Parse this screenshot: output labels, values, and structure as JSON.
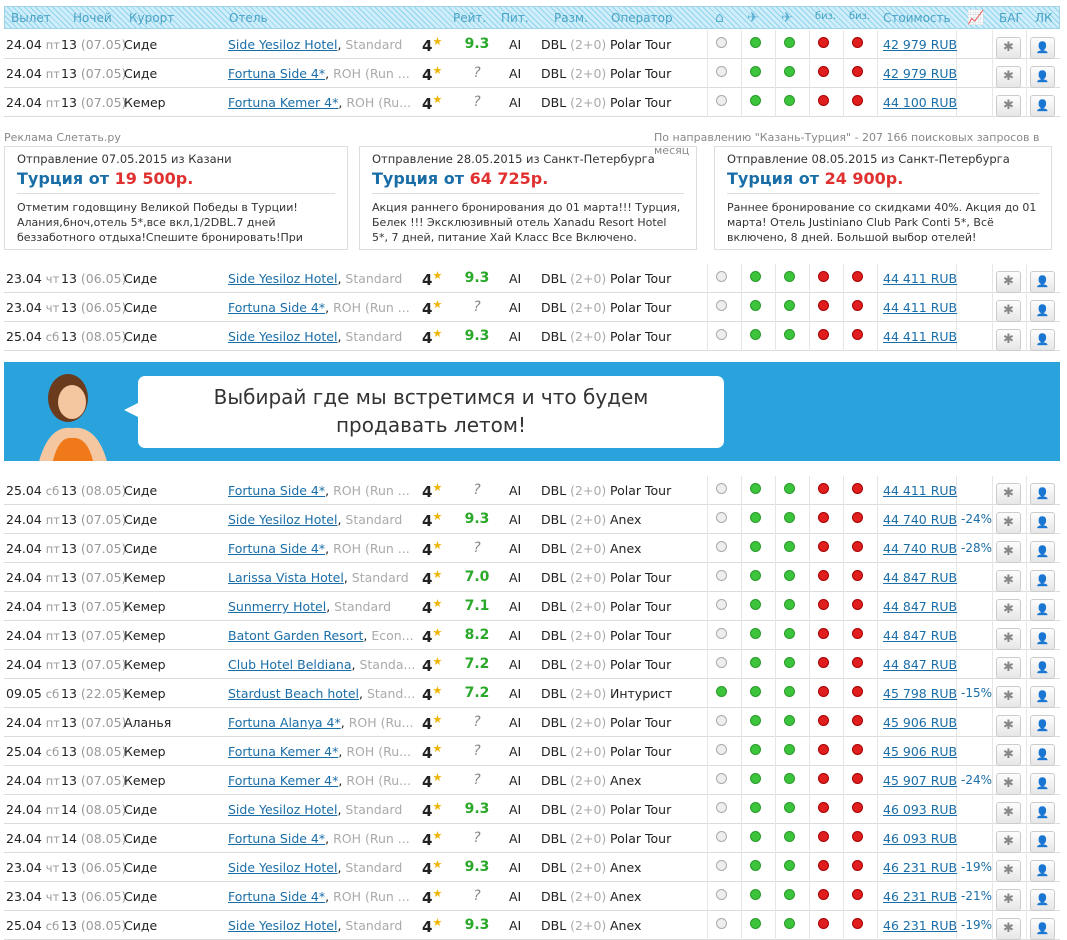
{
  "header": {
    "depart": "Вылет",
    "nights": "Ночей",
    "resort": "Курорт",
    "hotel": "Отель",
    "rating": "Рейт.",
    "meal": "Пит.",
    "room": "Разм.",
    "operator": "Оператор",
    "price": "Стоимость",
    "bag": "БАГ",
    "lk": "ЛК",
    "biz1": "биз.",
    "biz2": "биз."
  },
  "rows1": [
    {
      "date": "24.04",
      "dow": "пт",
      "nights": "13",
      "ret": "(07.05)",
      "resort": "Сиде",
      "hotel": "Side Yesiloz Hotel",
      "cat": "Standard",
      "stars": "4",
      "rating": "9.3",
      "meal": "AI",
      "room": "DBL",
      "rg": "(2+0)",
      "operator": "Polar Tour",
      "price": "42 979 RUB",
      "discount": "",
      "dots": "eggrr"
    },
    {
      "date": "24.04",
      "dow": "пт",
      "nights": "13",
      "ret": "(07.05)",
      "resort": "Сиде",
      "hotel": "Fortuna Side 4*",
      "cat": "ROH (Run ...",
      "stars": "4",
      "rating": "?",
      "meal": "AI",
      "room": "DBL",
      "rg": "(2+0)",
      "operator": "Polar Tour",
      "price": "42 979 RUB",
      "discount": "",
      "dots": "eggrr"
    },
    {
      "date": "24.04",
      "dow": "пт",
      "nights": "13",
      "ret": "(07.05)",
      "resort": "Кемер",
      "hotel": "Fortuna Kemer 4*",
      "cat": "ROH (Ru...",
      "stars": "4",
      "rating": "?",
      "meal": "AI",
      "room": "DBL",
      "rg": "(2+0)",
      "operator": "Polar Tour",
      "price": "44 100 RUB",
      "discount": "",
      "dots": "eggrr"
    }
  ],
  "ad": {
    "label": "Реклама Слетать.ру",
    "stats": "По направлению \"Казань-Турция\" - 207 166 поисковых запросов в месяц",
    "boxes": [
      {
        "depart": "Отправление 07.05.2015 из Казани",
        "dest": "Турция от",
        "price": "19 500р.",
        "text": "Отметим годовщину Великой Победы в Турции! Алания,6ноч,отель 5*,все вкл,1/2DBL.7 дней беззаботного отдыха!Спешите бронировать!При"
      },
      {
        "depart": "Отправление 28.05.2015 из Санкт-Петербурга",
        "dest": "Турция от",
        "price": "64 725р.",
        "text": "Акция раннего бронирования до 01 марта!!! Турция, Белек !!! Эксклюзивный отель Xanadu Resort Hotel 5*, 7 дней, питание Хай Класс Все Включено."
      },
      {
        "depart": "Отправление 08.05.2015 из Санкт-Петербурга",
        "dest": "Турция от",
        "price": "24 900р.",
        "text": "Раннее бронирование со скидками 40%. Акция до 01 марта! Отель Justiniano Club Park Conti 5*, Всё включено, 8 дней. Большой выбор отелей!"
      }
    ]
  },
  "rows2": [
    {
      "date": "23.04",
      "dow": "чт",
      "nights": "13",
      "ret": "(06.05)",
      "resort": "Сиде",
      "hotel": "Side Yesiloz Hotel",
      "cat": "Standard",
      "stars": "4",
      "rating": "9.3",
      "meal": "AI",
      "room": "DBL",
      "rg": "(2+0)",
      "operator": "Polar Tour",
      "price": "44 411 RUB",
      "discount": "",
      "dots": "eggrr"
    },
    {
      "date": "23.04",
      "dow": "чт",
      "nights": "13",
      "ret": "(06.05)",
      "resort": "Сиде",
      "hotel": "Fortuna Side 4*",
      "cat": "ROH (Run ...",
      "stars": "4",
      "rating": "?",
      "meal": "AI",
      "room": "DBL",
      "rg": "(2+0)",
      "operator": "Polar Tour",
      "price": "44 411 RUB",
      "discount": "",
      "dots": "eggrr"
    },
    {
      "date": "25.04",
      "dow": "сб",
      "nights": "13",
      "ret": "(08.05)",
      "resort": "Сиде",
      "hotel": "Side Yesiloz Hotel",
      "cat": "Standard",
      "stars": "4",
      "rating": "9.3",
      "meal": "AI",
      "room": "DBL",
      "rg": "(2+0)",
      "operator": "Polar Tour",
      "price": "44 411 RUB",
      "discount": "",
      "dots": "eggrr"
    }
  ],
  "banner": {
    "line1": "Выбирай где мы встретимся и что будем",
    "line2": "продавать летом!"
  },
  "rows3": [
    {
      "date": "25.04",
      "dow": "сб",
      "nights": "13",
      "ret": "(08.05)",
      "resort": "Сиде",
      "hotel": "Fortuna Side 4*",
      "cat": "ROH (Run ...",
      "stars": "4",
      "rating": "?",
      "meal": "AI",
      "room": "DBL",
      "rg": "(2+0)",
      "operator": "Polar Tour",
      "price": "44 411 RUB",
      "discount": "",
      "dots": "eggrr"
    },
    {
      "date": "24.04",
      "dow": "пт",
      "nights": "13",
      "ret": "(07.05)",
      "resort": "Сиде",
      "hotel": "Side Yesiloz Hotel",
      "cat": "Standard",
      "stars": "4",
      "rating": "9.3",
      "meal": "AI",
      "room": "DBL",
      "rg": "(2+0)",
      "operator": "Anex",
      "price": "44 740 RUB",
      "discount": "-24%",
      "dots": "eggrr"
    },
    {
      "date": "24.04",
      "dow": "пт",
      "nights": "13",
      "ret": "(07.05)",
      "resort": "Сиде",
      "hotel": "Fortuna Side 4*",
      "cat": "ROH (Run ...",
      "stars": "4",
      "rating": "?",
      "meal": "AI",
      "room": "DBL",
      "rg": "(2+0)",
      "operator": "Anex",
      "price": "44 740 RUB",
      "discount": "-28%",
      "dots": "eggrr"
    },
    {
      "date": "24.04",
      "dow": "пт",
      "nights": "13",
      "ret": "(07.05)",
      "resort": "Кемер",
      "hotel": "Larissa Vista Hotel",
      "cat": "Standard",
      "stars": "4",
      "rating": "7.0",
      "meal": "AI",
      "room": "DBL",
      "rg": "(2+0)",
      "operator": "Polar Tour",
      "price": "44 847 RUB",
      "discount": "",
      "dots": "eggrr"
    },
    {
      "date": "24.04",
      "dow": "пт",
      "nights": "13",
      "ret": "(07.05)",
      "resort": "Кемер",
      "hotel": "Sunmerry Hotel",
      "cat": "Standard",
      "stars": "4",
      "rating": "7.1",
      "meal": "AI",
      "room": "DBL",
      "rg": "(2+0)",
      "operator": "Polar Tour",
      "price": "44 847 RUB",
      "discount": "",
      "dots": "eggrr"
    },
    {
      "date": "24.04",
      "dow": "пт",
      "nights": "13",
      "ret": "(07.05)",
      "resort": "Кемер",
      "hotel": "Batont Garden Resort",
      "cat": "Econ...",
      "stars": "4",
      "rating": "8.2",
      "meal": "AI",
      "room": "DBL",
      "rg": "(2+0)",
      "operator": "Polar Tour",
      "price": "44 847 RUB",
      "discount": "",
      "dots": "eggrr"
    },
    {
      "date": "24.04",
      "dow": "пт",
      "nights": "13",
      "ret": "(07.05)",
      "resort": "Кемер",
      "hotel": "Club Hotel Beldiana",
      "cat": "Standa...",
      "stars": "4",
      "rating": "7.2",
      "meal": "AI",
      "room": "DBL",
      "rg": "(2+0)",
      "operator": "Polar Tour",
      "price": "44 847 RUB",
      "discount": "",
      "dots": "eggrr"
    },
    {
      "date": "09.05",
      "dow": "сб",
      "nights": "13",
      "ret": "(22.05)",
      "resort": "Кемер",
      "hotel": "Stardust Beach hotel",
      "cat": "Stand...",
      "stars": "4",
      "rating": "7.2",
      "meal": "AI",
      "room": "DBL",
      "rg": "(2+0)",
      "operator": "Интурист",
      "price": "45 798 RUB",
      "discount": "-15%",
      "dots": "gggrr"
    },
    {
      "date": "24.04",
      "dow": "пт",
      "nights": "13",
      "ret": "(07.05)",
      "resort": "Аланья",
      "hotel": "Fortuna Alanya 4*",
      "cat": "ROH (Ru...",
      "stars": "4",
      "rating": "?",
      "meal": "AI",
      "room": "DBL",
      "rg": "(2+0)",
      "operator": "Polar Tour",
      "price": "45 906 RUB",
      "discount": "",
      "dots": "eggrr"
    },
    {
      "date": "25.04",
      "dow": "сб",
      "nights": "13",
      "ret": "(08.05)",
      "resort": "Кемер",
      "hotel": "Fortuna Kemer 4*",
      "cat": "ROH (Ru...",
      "stars": "4",
      "rating": "?",
      "meal": "AI",
      "room": "DBL",
      "rg": "(2+0)",
      "operator": "Polar Tour",
      "price": "45 906 RUB",
      "discount": "",
      "dots": "eggrr"
    },
    {
      "date": "24.04",
      "dow": "пт",
      "nights": "13",
      "ret": "(07.05)",
      "resort": "Кемер",
      "hotel": "Fortuna Kemer 4*",
      "cat": "ROH (Ru...",
      "stars": "4",
      "rating": "?",
      "meal": "AI",
      "room": "DBL",
      "rg": "(2+0)",
      "operator": "Anex",
      "price": "45 907 RUB",
      "discount": "-24%",
      "dots": "eggrr"
    },
    {
      "date": "24.04",
      "dow": "пт",
      "nights": "14",
      "ret": "(08.05)",
      "resort": "Сиде",
      "hotel": "Side Yesiloz Hotel",
      "cat": "Standard",
      "stars": "4",
      "rating": "9.3",
      "meal": "AI",
      "room": "DBL",
      "rg": "(2+0)",
      "operator": "Polar Tour",
      "price": "46 093 RUB",
      "discount": "",
      "dots": "eggrr"
    },
    {
      "date": "24.04",
      "dow": "пт",
      "nights": "14",
      "ret": "(08.05)",
      "resort": "Сиде",
      "hotel": "Fortuna Side 4*",
      "cat": "ROH (Run ...",
      "stars": "4",
      "rating": "?",
      "meal": "AI",
      "room": "DBL",
      "rg": "(2+0)",
      "operator": "Polar Tour",
      "price": "46 093 RUB",
      "discount": "",
      "dots": "eggrr"
    },
    {
      "date": "23.04",
      "dow": "чт",
      "nights": "13",
      "ret": "(06.05)",
      "resort": "Сиде",
      "hotel": "Side Yesiloz Hotel",
      "cat": "Standard",
      "stars": "4",
      "rating": "9.3",
      "meal": "AI",
      "room": "DBL",
      "rg": "(2+0)",
      "operator": "Anex",
      "price": "46 231 RUB",
      "discount": "-19%",
      "dots": "eggrr"
    },
    {
      "date": "23.04",
      "dow": "чт",
      "nights": "13",
      "ret": "(06.05)",
      "resort": "Сиде",
      "hotel": "Fortuna Side 4*",
      "cat": "ROH (Run ...",
      "stars": "4",
      "rating": "?",
      "meal": "AI",
      "room": "DBL",
      "rg": "(2+0)",
      "operator": "Anex",
      "price": "46 231 RUB",
      "discount": "-21%",
      "dots": "eggrr"
    },
    {
      "date": "25.04",
      "dow": "сб",
      "nights": "13",
      "ret": "(08.05)",
      "resort": "Сиде",
      "hotel": "Side Yesiloz Hotel",
      "cat": "Standard",
      "stars": "4",
      "rating": "9.3",
      "meal": "AI",
      "room": "DBL",
      "rg": "(2+0)",
      "operator": "Anex",
      "price": "46 231 RUB",
      "discount": "-19%",
      "dots": "eggrr"
    }
  ],
  "icons": {
    "col1": "hotel-icon",
    "col2": "flight-icon",
    "col3": "flight-return-icon",
    "chart": "chart-icon",
    "bug": "bug-icon",
    "user": "user-icon"
  }
}
